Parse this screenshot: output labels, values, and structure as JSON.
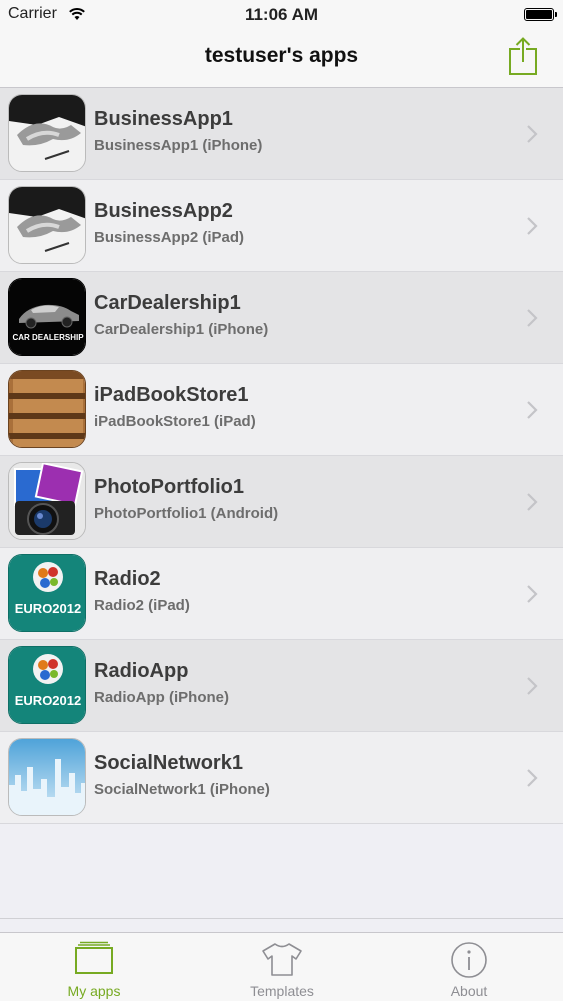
{
  "status": {
    "carrier": "Carrier",
    "time": "11:06 AM"
  },
  "nav": {
    "title": "testuser's apps",
    "share_icon": "share-icon",
    "accent": "#77aa22"
  },
  "apps": [
    {
      "name": "BusinessApp1",
      "subtitle": "BusinessApp1 (iPhone)",
      "icon": "handshake-icon"
    },
    {
      "name": "BusinessApp2",
      "subtitle": "BusinessApp2 (iPad)",
      "icon": "handshake-icon"
    },
    {
      "name": "CarDealership1",
      "subtitle": "CarDealership1 (iPhone)",
      "icon": "car-dealership-icon",
      "icon_text": "CAR DEALERSHIP"
    },
    {
      "name": "iPadBookStore1",
      "subtitle": "iPadBookStore1 (iPad)",
      "icon": "bookshelf-icon"
    },
    {
      "name": "PhotoPortfolio1",
      "subtitle": "PhotoPortfolio1 (Android)",
      "icon": "camera-icon"
    },
    {
      "name": "Radio2",
      "subtitle": "Radio2 (iPad)",
      "icon": "euro2012-icon",
      "icon_text": "EURO2012"
    },
    {
      "name": "RadioApp",
      "subtitle": "RadioApp (iPhone)",
      "icon": "euro2012-icon",
      "icon_text": "EURO2012"
    },
    {
      "name": "SocialNetwork1",
      "subtitle": "SocialNetwork1 (iPhone)",
      "icon": "skyline-icon"
    }
  ],
  "tabs": [
    {
      "label": "My apps",
      "icon": "folder-icon",
      "active": true
    },
    {
      "label": "Templates",
      "icon": "tshirt-icon",
      "active": false
    },
    {
      "label": "About",
      "icon": "info-icon",
      "active": false
    }
  ]
}
